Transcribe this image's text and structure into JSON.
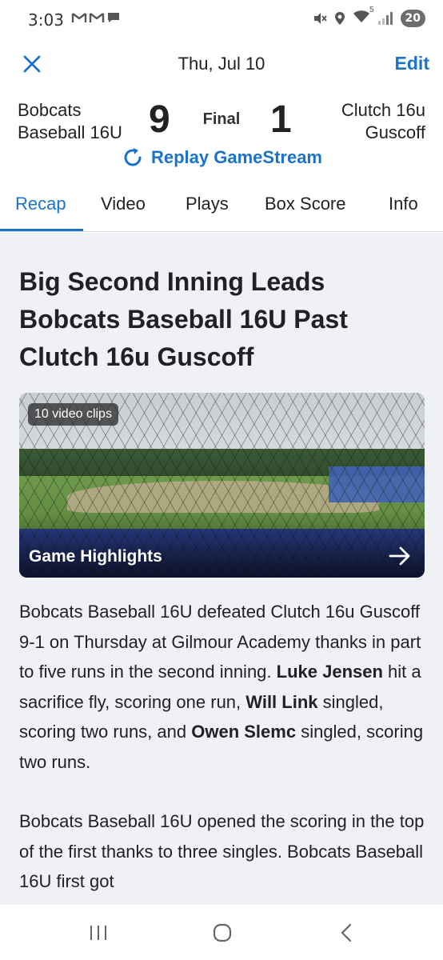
{
  "status_bar": {
    "time": "3:03",
    "notification_icons": [
      "gmail-icon",
      "gmail-icon",
      "chat-icon"
    ],
    "right_icons": [
      "mute-icon",
      "location-icon",
      "wifi-icon",
      "signal-icon"
    ],
    "wifi_label": "5",
    "badge": "20"
  },
  "header": {
    "date": "Thu, Jul 10",
    "edit_label": "Edit"
  },
  "game": {
    "home_team_line1": "Bobcats",
    "home_team_line2": "Baseball 16U",
    "home_score": "9",
    "status": "Final",
    "away_score": "1",
    "away_team_line1": "Clutch 16u",
    "away_team_line2": "Guscoff",
    "replay_label": "Replay GameStream"
  },
  "tabs": [
    {
      "label": "Recap",
      "active": true
    },
    {
      "label": "Video",
      "active": false
    },
    {
      "label": "Plays",
      "active": false
    },
    {
      "label": "Box Score",
      "active": false
    },
    {
      "label": "Info",
      "active": false
    }
  ],
  "recap": {
    "headline": "Big Second Inning Leads Bobcats Baseball 16U Past Clutch 16u Guscoff",
    "video": {
      "clips_label": "10 video clips",
      "title": "Game Highlights"
    },
    "paragraph1": {
      "part1": "Bobcats Baseball 16U defeated Clutch 16u Guscoff 9-1 on Thursday at Gilmour Academy thanks in part to five runs in the second inning.  ",
      "player1": "Luke Jensen",
      "part2": " hit a sacrifice fly, scoring one run, ",
      "player2": "Will Link",
      "part3": " singled, scoring two runs, and ",
      "player3": "Owen Slemc",
      "part4": " singled, scoring two runs."
    },
    "paragraph2": "Bobcats Baseball 16U opened the scoring in the top of the first thanks to three singles. Bobcats Baseball 16U first got"
  },
  "nav_bar": [
    "recents-icon",
    "home-icon",
    "back-icon"
  ],
  "colors": {
    "accent": "#1a73c9",
    "content_bg": "#f0f1f5"
  }
}
